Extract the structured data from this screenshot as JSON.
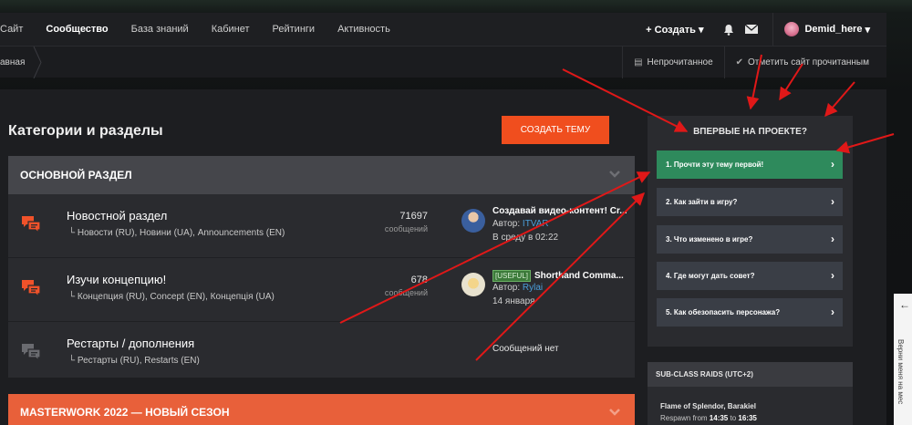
{
  "nav": {
    "items": [
      "Сайт",
      "Сообщество",
      "База знаний",
      "Кабинет",
      "Рейтинги",
      "Активность"
    ],
    "create_label": "+ Создать",
    "username": "Demid_here"
  },
  "subbar": {
    "breadcrumb": "авная",
    "unread_label": "Непрочитанное",
    "mark_read_label": "Отметить сайт прочитанным"
  },
  "main": {
    "title": "Категории и разделы",
    "create_topic": "СОЗДАТЬ ТЕМУ"
  },
  "category": {
    "title": "ОСНОВНОЙ РАЗДЕЛ",
    "forums": [
      {
        "title": "Новостной раздел",
        "subs": "Новости (RU),  Новини (UA),  Announcements (EN)",
        "count": "71697",
        "count_label": "сообщений",
        "last_title": "Создавай видео-контент! Cr...",
        "last_author_prefix": "Автор: ",
        "last_author": "ITVAR",
        "last_time": "В среду в 02:22"
      },
      {
        "title": "Изучи концепцию!",
        "subs": "Концепция (RU),  Concept (EN),  Концепція (UA)",
        "count": "678",
        "count_label": "сообщений",
        "last_tag": "[USEFUL]",
        "last_title": "Shorthand Comma...",
        "last_author_prefix": "Автор: ",
        "last_author": "Rylai",
        "last_time": "14 января"
      },
      {
        "title": "Рестарты / дополнения",
        "subs": "Рестарты (RU),  Restarts (EN)",
        "no_messages": "Сообщений нет"
      }
    ]
  },
  "category2": {
    "title": "MASTERWORK 2022 — НОВЫЙ СЕЗОН"
  },
  "sidebar": {
    "title": "ВПЕРВЫЕ НА ПРОЕКТЕ?",
    "items": [
      "1. Прочти эту тему первой!",
      "2. Как зайти в игру?",
      "3. Что изменено в игре?",
      "4. Где могут дать совет?",
      "5. Как обезопасить персонажа?"
    ],
    "raids": {
      "title": "SUB-CLASS RAIDS (UTC+2)",
      "name": "Flame of Splendor, Barakiel",
      "respawn_prefix": "Respawn from ",
      "from": "14:35",
      "to_word": " to ",
      "to": "16:35"
    }
  },
  "edge": {
    "text": "Верни меня на мес"
  },
  "colors": {
    "accent": "#f04e1e",
    "green": "#2e8a5c",
    "link": "#4a9eda"
  }
}
